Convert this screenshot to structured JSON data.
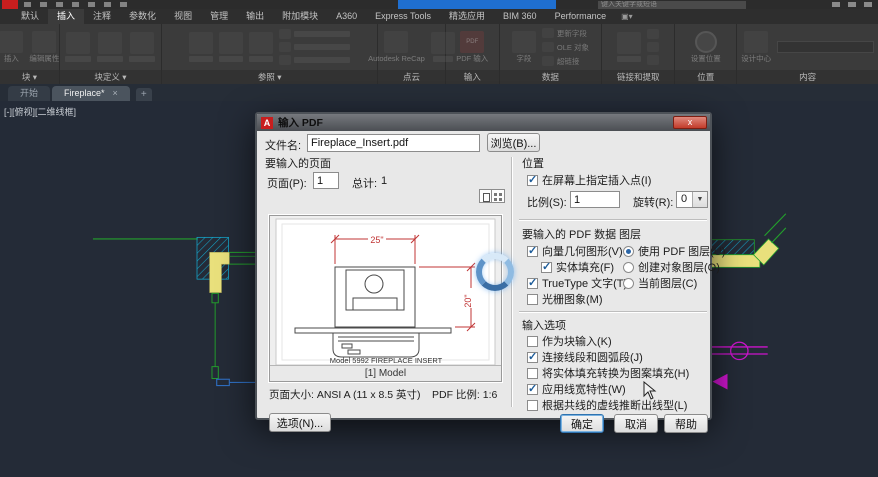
{
  "colors": {
    "canvas_bg": "#242b37",
    "accent_blue": "#1f6fd0",
    "brand_red": "#c81e1e",
    "wall_yellow": "#e9e07c",
    "hatch_cyan": "#15a3c7",
    "line_green": "#23a12c",
    "line_blue": "#2f6fc2",
    "line_magenta": "#cc14cc",
    "dim_red": "#c03434",
    "geo_dark": "#4a4a4a"
  },
  "titlebar": {
    "search_text": "键入关键字或短语"
  },
  "ribbon": {
    "tabs": [
      {
        "label": "默认"
      },
      {
        "label": "插入"
      },
      {
        "label": "注释"
      },
      {
        "label": "参数化"
      },
      {
        "label": "视图"
      },
      {
        "label": "管理"
      },
      {
        "label": "输出"
      },
      {
        "label": "附加模块"
      },
      {
        "label": "A360"
      },
      {
        "label": "Express Tools"
      },
      {
        "label": "精选应用"
      },
      {
        "label": "BIM 360"
      },
      {
        "label": "Performance"
      }
    ],
    "panels": {
      "block": {
        "label": "块 ▾",
        "btn1": "插入",
        "btn2": "编辑属性"
      },
      "block_def": {
        "label": "块定义 ▾"
      },
      "reference": {
        "label": "参照 ▾"
      },
      "point_cloud": {
        "label": "点云",
        "btn1": "Autodesk ReCap"
      },
      "import": {
        "label": "输入",
        "btn1": "PDF 输入"
      },
      "data": {
        "label": "数据",
        "btn1": "字段",
        "row1": "更新字段",
        "row2": "OLE 对象",
        "row3": "超链接"
      },
      "linking": {
        "label": "链接和提取"
      },
      "location": {
        "label": "位置",
        "btn1": "设置位置"
      },
      "content": {
        "label": "内容",
        "btn1": "设计中心"
      }
    }
  },
  "file_tabs": {
    "start": "开始",
    "drawing": "Fireplace*",
    "close_glyph": "×",
    "new_glyph": "+"
  },
  "viewport_label": "[-][俯视][二维线框]",
  "dialog": {
    "title": "输入 PDF",
    "close_glyph": "x",
    "file_label": "文件名:",
    "file_value": "Fireplace_Insert.pdf",
    "browse_button": "浏览(B)...",
    "pages": {
      "heading": "要输入的页面",
      "page_label": "页面(P):",
      "page_value": "1",
      "total_label": "总计:",
      "total_value": "1",
      "preview_caption": "[1] Model",
      "page_size": "页面大小: ANSI A (11 x 8.5 英寸)",
      "pdf_scale": "PDF 比例: 1:6",
      "drawing": {
        "dim_width": "25\"",
        "dim_height": "20\"",
        "title": "Model 5992 FIREPLACE INSERT"
      }
    },
    "options_button": "选项(N)...",
    "location": {
      "heading": "位置",
      "specify_on_screen": {
        "label": "在屏幕上指定插入点(I)",
        "checked": true
      },
      "scale_label": "比例(S):",
      "scale_value": "1",
      "rotation_label": "旋转(R):",
      "rotation_value": "0"
    },
    "pdf_data": {
      "heading": "要输入的 PDF 数据",
      "vector_geometry": {
        "label": "向量几何图形(V)",
        "checked": true
      },
      "solid_fills": {
        "label": "实体填充(F)",
        "checked": true
      },
      "truetype_text": {
        "label": "TrueType 文字(T)",
        "checked": true
      },
      "raster_images": {
        "label": "光栅图象(M)",
        "checked": false
      }
    },
    "layers": {
      "heading": "图层",
      "use_pdf_layers": {
        "label": "使用 PDF 图层(U)",
        "selected": true
      },
      "create_object_layers": {
        "label": "创建对象图层(O)",
        "selected": false
      },
      "current_layer": {
        "label": "当前图层(C)",
        "selected": false
      }
    },
    "import_options": {
      "heading": "输入选项",
      "import_as_block": {
        "label": "作为块输入(K)",
        "checked": false
      },
      "join_segments": {
        "label": "连接线段和圆弧段(J)",
        "checked": true
      },
      "convert_solids_to_hatches": {
        "label": "将实体填充转换为图案填充(H)",
        "checked": false
      },
      "apply_lineweight": {
        "label": "应用线宽特性(W)",
        "checked": true
      },
      "infer_linetypes": {
        "label": "根据共线的虚线推断出线型(L)",
        "checked": false
      }
    },
    "ok_button": "确定",
    "cancel_button": "取消",
    "help_button": "帮助"
  }
}
